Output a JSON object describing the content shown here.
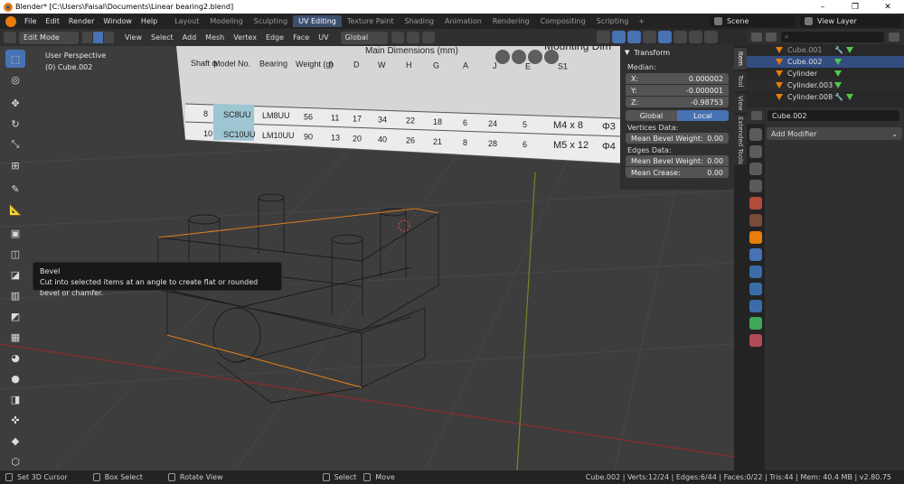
{
  "window": {
    "title": "Blender* [C:\\Users\\Faisal\\Documents\\Linear bearing2.blend]",
    "controls": [
      "–",
      "❐",
      "✕"
    ]
  },
  "menu": [
    "File",
    "Edit",
    "Render",
    "Window",
    "Help"
  ],
  "workspaces": [
    "Layout",
    "Modeling",
    "Sculpting",
    "UV Editing",
    "Texture Paint",
    "Shading",
    "Animation",
    "Rendering",
    "Compositing",
    "Scripting"
  ],
  "active_workspace": "UV Editing",
  "workspace_add": "+",
  "scene": "Scene",
  "view_layer": "View Layer",
  "viewport_header": {
    "mode": "Edit Mode",
    "items": [
      "View",
      "Select",
      "Add",
      "Mesh",
      "Vertex",
      "Edge",
      "Face",
      "UV"
    ],
    "orientation": "Global"
  },
  "viewport": {
    "perspective": "User Perspective",
    "object": "(0) Cube.002"
  },
  "tooltip": {
    "title": "Bevel",
    "description": "Cut into selected items at an angle to create flat or rounded bevel or chamfer."
  },
  "reference_image": {
    "title": "Mounting Dim",
    "subtitle": "Main Dimensions (mm)",
    "headers": [
      "Shaft φ",
      "Model No.",
      "Bearing",
      "Weight (g)",
      "h",
      "D",
      "W",
      "H",
      "G",
      "A",
      "J",
      "E",
      "S1"
    ],
    "rows": [
      [
        "8",
        "SC8UU",
        "LM8UU",
        "56",
        "11",
        "17",
        "34",
        "22",
        "18",
        "6",
        "24",
        "5",
        "M4 x 8",
        "Φ3"
      ],
      [
        "10",
        "SC10UU",
        "LM10UU",
        "90",
        "13",
        "20",
        "40",
        "26",
        "21",
        "8",
        "28",
        "6",
        "M5 x 12",
        "Φ4"
      ]
    ]
  },
  "transform_panel": {
    "title": "Transform",
    "median_label": "Median:",
    "median": [
      {
        "axis": "X:",
        "value": "0.000002"
      },
      {
        "axis": "Y:",
        "value": "-0.000001"
      },
      {
        "axis": "Z:",
        "value": "-0.98753"
      }
    ],
    "space": [
      "Global",
      "Local"
    ],
    "active_space": "Local",
    "vertices_data_label": "Vertices Data:",
    "vertices_mean_bevel_weight": {
      "label": "Mean Bevel Weight:",
      "value": "0.00"
    },
    "edges_data_label": "Edges Data:",
    "edges_mean_bevel_weight": {
      "label": "Mean Bevel Weight:",
      "value": "0.00"
    },
    "edges_mean_crease": {
      "label": "Mean Crease:",
      "value": "0.00"
    }
  },
  "sidebar_tabs": [
    "Item",
    "Tool",
    "View",
    "Extended Tools"
  ],
  "outliner": {
    "rows": [
      {
        "name": "Cube.001",
        "dim": true,
        "wrench": true,
        "selected": false
      },
      {
        "name": "Cube.002",
        "dim": false,
        "wrench": false,
        "selected": true
      },
      {
        "name": "Cylinder",
        "dim": false,
        "wrench": false,
        "selected": false
      },
      {
        "name": "Cylinder.003",
        "dim": false,
        "wrench": false,
        "selected": false
      },
      {
        "name": "Cylinder.008",
        "dim": false,
        "wrench": true,
        "selected": false
      }
    ]
  },
  "properties": {
    "object": "Cube.002",
    "add_modifier": "Add Modifier"
  },
  "status": {
    "items": [
      "Set 3D Cursor",
      "Box Select",
      "Rotate View",
      "Select",
      "Move"
    ],
    "stats": "Cube.002 | Verts:12/24 | Edges:6/44 | Faces:0/22 | Tris:44 | Mem: 40.4 MB | v2.80.75"
  },
  "colors": {
    "accent": "#4772b3",
    "object_orange": "#e87d0d",
    "viewport_bg": "#3d3d3d"
  }
}
